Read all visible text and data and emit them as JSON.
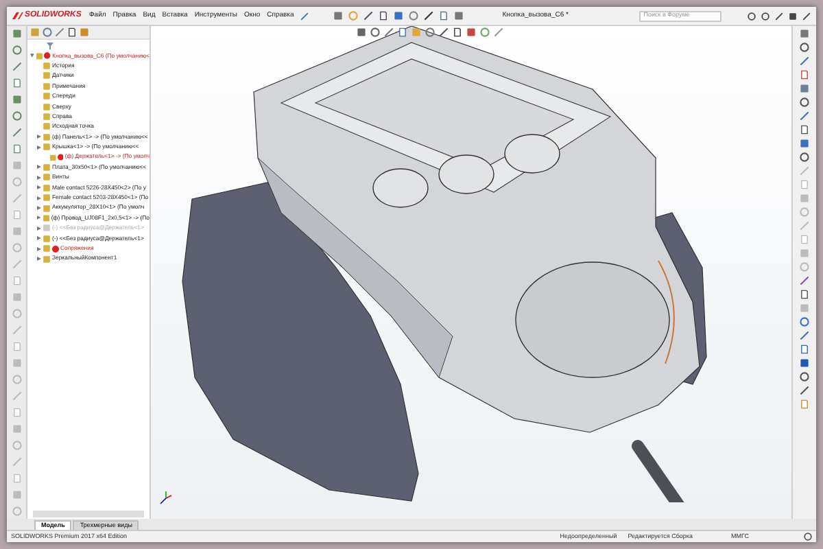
{
  "app": {
    "logo": "SOLIDWORKS"
  },
  "menu": [
    "Файл",
    "Правка",
    "Вид",
    "Вставка",
    "Инструменты",
    "Окно",
    "Справка"
  ],
  "window": {
    "title": "Кнопка_вызова_C6 *"
  },
  "search": {
    "placeholder": "Поиск в Форуме"
  },
  "tree": {
    "label": "Кнопка_вызова_C6  (По умолчанию<",
    "error": true,
    "expanded": true,
    "children": [
      {
        "label": "История",
        "error": false,
        "suppressed": false
      },
      {
        "label": "Датчики",
        "error": false,
        "suppressed": false
      },
      {
        "label": "Примечания",
        "error": false,
        "suppressed": false
      },
      {
        "label": "Спереди",
        "error": false,
        "suppressed": false
      },
      {
        "label": "Сверху",
        "error": false,
        "suppressed": false
      },
      {
        "label": "Справа",
        "error": false,
        "suppressed": false
      },
      {
        "label": "Исходная точка",
        "error": false,
        "suppressed": false
      },
      {
        "label": "(ф) Панель<1> -> (По умолчанию<<",
        "error": false,
        "suppressed": false
      },
      {
        "label": "Крышка<1> -> (По умолчанию<<",
        "error": false,
        "suppressed": false,
        "children": [
          {
            "label": "(ф) Держатель<1> -> (По умолч",
            "error": true,
            "suppressed": false
          }
        ]
      },
      {
        "label": "Плата_30x50<1> (По умолчанию<<",
        "error": false,
        "suppressed": false
      },
      {
        "label": "Винты",
        "error": false,
        "suppressed": false
      },
      {
        "label": "Male contact 5226-28X450<2> (По у",
        "error": false,
        "suppressed": false
      },
      {
        "label": "Female contact 5203-28X450<1> (По",
        "error": false,
        "suppressed": false
      },
      {
        "label": "Аккумулятор_28X10<1> (По умолч",
        "error": false,
        "suppressed": false
      },
      {
        "label": "(ф) Провод_UJ08F1_2x0,5<1> -> (По",
        "error": false,
        "suppressed": false
      },
      {
        "label": "(-) <<Без радиуса@Держатель<1>",
        "error": false,
        "suppressed": true
      },
      {
        "label": "(-) <<Без радиуса@Держатель<1>",
        "error": false,
        "suppressed": false
      },
      {
        "label": "Сопряжения",
        "error": true,
        "suppressed": false
      },
      {
        "label": "ЗеркальныйКомпонент1",
        "error": false,
        "suppressed": false
      }
    ]
  },
  "tabs": [
    {
      "label": "Модель",
      "selected": true
    },
    {
      "label": "Трехмерные виды",
      "selected": false
    }
  ],
  "status_bar": {
    "edition": "SOLIDWORKS Premium 2017 x64 Edition",
    "state": "Недоопределенный",
    "mode": "Редактируется Сборка",
    "units": "ММГС"
  }
}
